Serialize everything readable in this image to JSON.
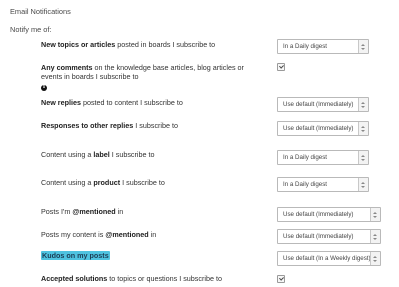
{
  "page": {
    "section_title": "Email Notifications",
    "notify_label": "Notify me of:"
  },
  "rows": [
    {
      "pre": "",
      "bold": "New topics or articles",
      "post": " posted in boards I subscribe to",
      "control": "select",
      "value": "In a Daily digest"
    },
    {
      "pre": "",
      "bold": "Any comments",
      "post": " on the knowledge base articles, blog articles or",
      "line2": "events in boards I subscribe to",
      "control": "checkbox",
      "checked": true,
      "info_icon": "info-icon"
    },
    {
      "pre": "",
      "bold": "New replies",
      "post": " posted to content I subscribe to",
      "control": "select",
      "value": "Use default (Immediately)"
    },
    {
      "pre": "",
      "bold": "Responses to other replies",
      "post": " I subscribe to",
      "control": "select",
      "value": "Use default (Immediately)"
    },
    {
      "pre": "Content using a ",
      "bold": "label",
      "post": " I subscribe to",
      "control": "select",
      "value": "In a Daily digest"
    },
    {
      "pre": "Content using a ",
      "bold": "product",
      "post": " I subscribe to",
      "control": "select",
      "value": "In a Daily digest"
    },
    {
      "pre": "Posts I'm ",
      "bold": "@mentioned",
      "post": " in",
      "control": "select",
      "value": "Use default (Immediately)"
    },
    {
      "pre": "Posts my content is ",
      "bold": "@mentioned",
      "post": " in",
      "control": "select",
      "value": "Use default (Immediately)"
    },
    {
      "pre": "",
      "bold": "Kudos on my posts",
      "post": "",
      "control": "select",
      "value": "Use default (In a Weekly digest)",
      "highlight": true
    },
    {
      "pre": "",
      "bold": "Accepted solutions",
      "post": " to topics or questions I subscribe to",
      "control": "checkbox",
      "checked": true
    }
  ],
  "colors": {
    "highlight": "#4fc3e0",
    "select_border": "#b9b9b9",
    "text": "#333333"
  }
}
